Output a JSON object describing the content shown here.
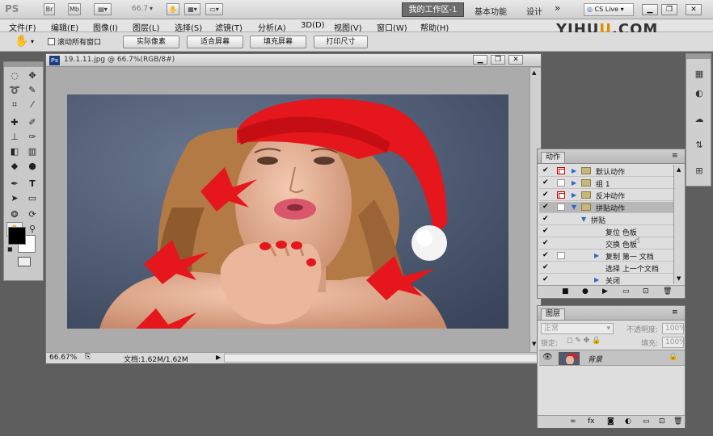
{
  "app": {
    "logo_text": "PS",
    "zoom": "66.7",
    "workspaces": [
      "我的工作区-1",
      "基本功能",
      "设计"
    ],
    "more": "»",
    "cslive": "CS Live"
  },
  "menu": [
    "文件(F)",
    "编辑(E)",
    "图像(I)",
    "图层(L)",
    "选择(S)",
    "滤镜(T)",
    "分析(A)",
    "3D(D)",
    "视图(V)",
    "窗口(W)",
    "帮助(H)"
  ],
  "watermark": {
    "part1": "YIHU",
    "part2": "U",
    "part3": ".COM"
  },
  "options": {
    "scroll_all": "滚动所有窗口",
    "buttons": [
      "实际像素",
      "适合屏幕",
      "填充屏幕",
      "打印尺寸"
    ]
  },
  "document": {
    "title": "19.1.11.jpg @ 66.7%(RGB/8#)",
    "zoom": "66.67%",
    "doc_size": "文档:1.62M/1.62M"
  },
  "actions_panel": {
    "tab": "动作",
    "rows": [
      {
        "label": "默认动作",
        "type": "set",
        "dialog": "red",
        "selected": false
      },
      {
        "label": "组 1",
        "type": "set",
        "dialog": "plain",
        "selected": false
      },
      {
        "label": "反冲动作",
        "type": "set",
        "dialog": "red",
        "selected": false
      },
      {
        "label": "拼贴动作",
        "type": "set-open",
        "dialog": "plain",
        "selected": true
      },
      {
        "label": "拼贴",
        "type": "action-open",
        "dialog": "none",
        "selected": false
      },
      {
        "label": "复位 色板",
        "type": "step",
        "dialog": "none",
        "selected": false
      },
      {
        "label": "交换 色板",
        "type": "step",
        "dialog": "none",
        "selected": false
      },
      {
        "label": "复制 第一 文档",
        "type": "step-tri",
        "dialog": "plain",
        "selected": false
      },
      {
        "label": "选择 上一个文档",
        "type": "step",
        "dialog": "none",
        "selected": false
      },
      {
        "label": "关闭",
        "type": "step-tri",
        "dialog": "none",
        "selected": false
      },
      {
        "label": "...",
        "type": "step-tri",
        "dialog": "none",
        "selected": false
      }
    ]
  },
  "layers_panel": {
    "tab": "图层",
    "blend_mode": "正常",
    "opacity_label": "不透明度:",
    "opacity_value": "100%",
    "lock_label": "锁定:",
    "fill_label": "填充:",
    "fill_value": "100%",
    "layer_name": "背景"
  },
  "colors": {
    "accent_hat": "#e5161c",
    "canvas_bg": "#4e5c73",
    "skin": "#e9b49a",
    "hair": "#b47a46"
  }
}
